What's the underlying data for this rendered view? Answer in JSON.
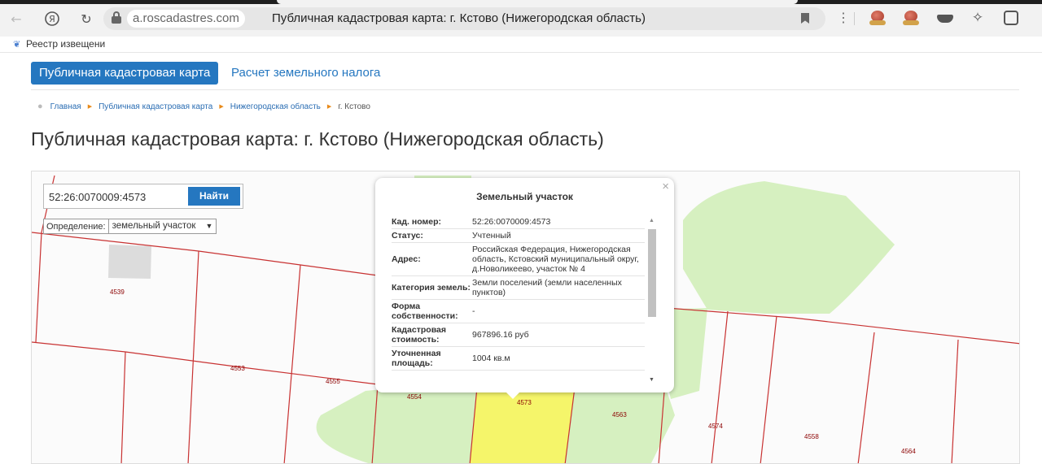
{
  "browser": {
    "domain": "a.roscadastres.com",
    "tab_title": "Публичная кадастровая карта: г. Кстово (Нижегородская область)",
    "bookmark_label": "Реестр извещени"
  },
  "nav": {
    "tab_active": "Публичная кадастровая карта",
    "tab_link": "Расчет земельного налога"
  },
  "breadcrumb": [
    {
      "label": "Главная"
    },
    {
      "label": "Публичная кадастровая карта"
    },
    {
      "label": "Нижегородская область"
    },
    {
      "label": "г. Кстово"
    }
  ],
  "page_title": "Публичная кадастровая карта: г. Кстово (Нижегородская область)",
  "search": {
    "value": "52:26:0070009:4573",
    "button_label": "Найти",
    "definition_label": "Определение:",
    "definition_value": "земельный участок"
  },
  "popup": {
    "title": "Земельный участок",
    "rows": [
      {
        "key": "Кад. номер:",
        "value": "52:26:0070009:4573"
      },
      {
        "key": "Статус:",
        "value": "Учтенный"
      },
      {
        "key": "Адрес:",
        "value": "Российская Федерация, Нижегородская область, Кстовский муниципальный округ, д.Новоликеево, участок № 4"
      },
      {
        "key": "Категория земель:",
        "value": "Земли поселений (земли населенных пунктов)"
      },
      {
        "key": "Форма собственности:",
        "value": "-"
      },
      {
        "key": "Кадастровая стоимость:",
        "value": "967896.16 руб"
      },
      {
        "key": "Уточненная площадь:",
        "value": "1004 кв.м"
      }
    ]
  },
  "map_labels": {
    "l4539": "4539",
    "l4553": "4553",
    "l4555": "4555",
    "l4554": "4554",
    "l4573": "4573",
    "l4563": "4563",
    "l4574": "4574",
    "l4558": "4558",
    "l4564": "4564"
  },
  "colors": {
    "accent": "#2577c0",
    "parcel_line": "#c83232",
    "selected_parcel": "#f5f56a",
    "green_zone": "#d6f0c0"
  }
}
